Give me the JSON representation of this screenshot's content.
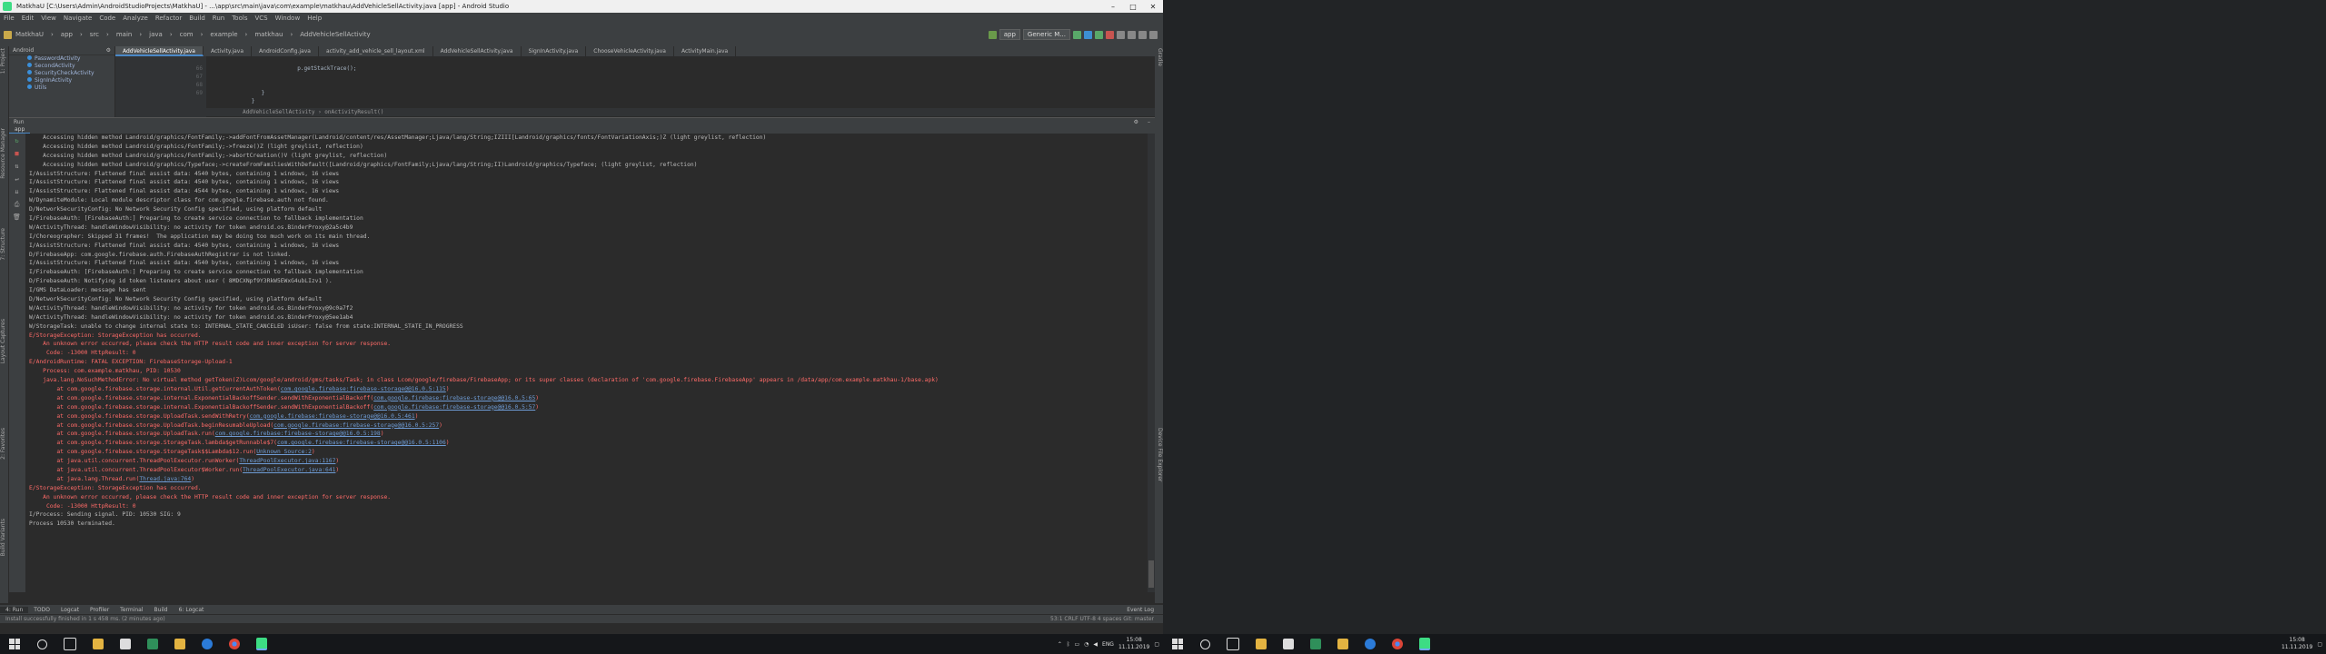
{
  "window": {
    "title": "MatkhaU [C:\\Users\\Admin\\AndroidStudioProjects\\MatkhaU] - ...\\app\\src\\main\\java\\com\\example\\matkhau\\AddVehicleSellActivity.java [app] - Android Studio"
  },
  "menu": [
    "File",
    "Edit",
    "View",
    "Navigate",
    "Code",
    "Analyze",
    "Refactor",
    "Build",
    "Run",
    "Tools",
    "VCS",
    "Window",
    "Help"
  ],
  "nav": {
    "crumbs": [
      "MatkhaU",
      "app",
      "src",
      "main",
      "java",
      "com",
      "example",
      "matkhau",
      "AddVehicleSellActivity"
    ],
    "run_config": "app",
    "device": "Generic M..."
  },
  "project": {
    "header": "Android",
    "items": [
      "PasswordActivity",
      "SecondActivity",
      "SecurityCheckActivity",
      "SignInActivity",
      "Utils"
    ]
  },
  "tabs": [
    "AddVehicleSellActivity.java",
    "Activity.java",
    "AndroidConfig.java",
    "activity_add_vehicle_sell_layout.xml",
    "AddVehicleSellActivity.java",
    "SignInActivity.java",
    "ChooseVehicleActivity.java",
    "ActivityMain.java"
  ],
  "editor": {
    "lines": [
      "",
      "                         p.getStackTrace();",
      "",
      "",
      "              }",
      "           }"
    ],
    "line_numbers": [
      "",
      "66",
      "67",
      "68",
      "69",
      ""
    ],
    "breadcrumb": "AddVehicleSellActivity  ›  onActivityResult()"
  },
  "run": {
    "panel_label": "Run",
    "tab": "app",
    "lines": [
      {
        "t": "    Accessing hidden method Landroid/graphics/FontFamily;->addFontFromAssetManager(Landroid/content/res/AssetManager;Ljava/lang/String;IZIII[Landroid/graphics/fonts/FontVariationAxis;)Z (light greylist, reflection)",
        "c": ""
      },
      {
        "t": "    Accessing hidden method Landroid/graphics/FontFamily;->freeze()Z (light greylist, reflection)",
        "c": ""
      },
      {
        "t": "    Accessing hidden method Landroid/graphics/FontFamily;->abortCreation()V (light greylist, reflection)",
        "c": ""
      },
      {
        "t": "    Accessing hidden method Landroid/graphics/Typeface;->createFromFamiliesWithDefault([Landroid/graphics/FontFamily;Ljava/lang/String;II)Landroid/graphics/Typeface; (light greylist, reflection)",
        "c": ""
      },
      {
        "t": "I/AssistStructure: Flattened final assist data: 4540 bytes, containing 1 windows, 16 views",
        "c": ""
      },
      {
        "t": "I/AssistStructure: Flattened final assist data: 4540 bytes, containing 1 windows, 16 views",
        "c": ""
      },
      {
        "t": "I/AssistStructure: Flattened final assist data: 4544 bytes, containing 1 windows, 16 views",
        "c": ""
      },
      {
        "t": "W/DynamiteModule: Local module descriptor class for com.google.firebase.auth not found.",
        "c": ""
      },
      {
        "t": "D/NetworkSecurityConfig: No Network Security Config specified, using platform default",
        "c": ""
      },
      {
        "t": "I/FirebaseAuth: [FirebaseAuth:] Preparing to create service connection to fallback implementation",
        "c": ""
      },
      {
        "t": "W/ActivityThread: handleWindowVisibility: no activity for token android.os.BinderProxy@2a5c4b9",
        "c": ""
      },
      {
        "t": "I/Choreographer: Skipped 31 frames!  The application may be doing too much work on its main thread.",
        "c": ""
      },
      {
        "t": "I/AssistStructure: Flattened final assist data: 4540 bytes, containing 1 windows, 16 views",
        "c": ""
      },
      {
        "t": "D/FirebaseApp: com.google.firebase.auth.FirebaseAuthRegistrar is not linked.",
        "c": ""
      },
      {
        "t": "I/AssistStructure: Flattened final assist data: 4540 bytes, containing 1 windows, 16 views",
        "c": ""
      },
      {
        "t": "I/FirebaseAuth: [FirebaseAuth:] Preparing to create service connection to fallback implementation",
        "c": ""
      },
      {
        "t": "D/FirebaseAuth: Notifying id token listeners about user ( 8MDCXNpf9Y3RkW5EWxG4ubLIzv1 ).",
        "c": ""
      },
      {
        "t": "I/GMS DataLoader: message has sent",
        "c": ""
      },
      {
        "t": "D/NetworkSecurityConfig: No Network Security Config specified, using platform default",
        "c": ""
      },
      {
        "t": "W/ActivityThread: handleWindowVisibility: no activity for token android.os.BinderProxy@9c0a7f2",
        "c": ""
      },
      {
        "t": "W/ActivityThread: handleWindowVisibility: no activity for token android.os.BinderProxy@5ee1ab4",
        "c": ""
      },
      {
        "t": "W/StorageTask: unable to change internal state to: INTERNAL_STATE_CANCELED isUser: false from state:INTERNAL_STATE_IN_PROGRESS",
        "c": ""
      },
      {
        "t": "E/StorageException: StorageException has occurred.",
        "c": "err"
      },
      {
        "t": "    An unknown error occurred, please check the HTTP result code and inner exception for server response.",
        "c": "err"
      },
      {
        "t": "     Code: -13000 HttpResult: 0",
        "c": "err"
      },
      {
        "t": "E/AndroidRuntime: FATAL EXCEPTION: FirebaseStorage-Upload-1",
        "c": "err"
      },
      {
        "t": "    Process: com.example.matkhau, PID: 10530",
        "c": "err"
      },
      {
        "t": "    java.lang.NoSuchMethodError: No virtual method getToken(Z)Lcom/google/android/gms/tasks/Task; in class Lcom/google/firebase/FirebaseApp; or its super classes (declaration of 'com.google.firebase.FirebaseApp' appears in /data/app/com.example.matkhau-1/base.apk)",
        "c": "err"
      },
      {
        "t": "        at com.google.firebase.storage.internal.Util.getCurrentAuthToken(",
        "c": "err",
        "u": "com.google.firebase:firebase-storage@@16.0.5:115",
        "tail": ")"
      },
      {
        "t": "        at com.google.firebase.storage.internal.ExponentialBackoffSender.sendWithExponentialBackoff(",
        "c": "err",
        "u": "com.google.firebase:firebase-storage@@16.0.5:65",
        "tail": ")"
      },
      {
        "t": "        at com.google.firebase.storage.internal.ExponentialBackoffSender.sendWithExponentialBackoff(",
        "c": "err",
        "u": "com.google.firebase:firebase-storage@@16.0.5:57",
        "tail": ")"
      },
      {
        "t": "        at com.google.firebase.storage.UploadTask.sendWithRetry(",
        "c": "err",
        "u": "com.google.firebase:firebase-storage@@16.0.5:461",
        "tail": ")"
      },
      {
        "t": "        at com.google.firebase.storage.UploadTask.beginResumableUpload(",
        "c": "err",
        "u": "com.google.firebase:firebase-storage@@16.0.5:257",
        "tail": ")"
      },
      {
        "t": "        at com.google.firebase.storage.UploadTask.run(",
        "c": "err",
        "u": "com.google.firebase:firebase-storage@@16.0.5:198",
        "tail": ")"
      },
      {
        "t": "        at com.google.firebase.storage.StorageTask.lambda$getRunnable$7(",
        "c": "err",
        "u": "com.google.firebase:firebase-storage@@16.0.5:1106",
        "tail": ")"
      },
      {
        "t": "        at com.google.firebase.storage.StorageTask$$Lambda$12.run(",
        "c": "err",
        "u": "Unknown Source:2",
        "tail": ")"
      },
      {
        "t": "        at java.util.concurrent.ThreadPoolExecutor.runWorker(",
        "c": "err",
        "u": "ThreadPoolExecutor.java:1167",
        "tail": ")"
      },
      {
        "t": "        at java.util.concurrent.ThreadPoolExecutor$Worker.run(",
        "c": "err",
        "u": "ThreadPoolExecutor.java:641",
        "tail": ")"
      },
      {
        "t": "        at java.lang.Thread.run(",
        "c": "err",
        "u": "Thread.java:764",
        "tail": ")"
      },
      {
        "t": "E/StorageException: StorageException has occurred.",
        "c": "err"
      },
      {
        "t": "    An unknown error occurred, please check the HTTP result code and inner exception for server response.",
        "c": "err"
      },
      {
        "t": "     Code: -13000 HttpResult: 0",
        "c": "err"
      },
      {
        "t": "I/Process: Sending signal. PID: 10530 SIG: 9",
        "c": ""
      },
      {
        "t": "Process 10530 terminated.",
        "c": ""
      },
      {
        "t": "",
        "c": ""
      }
    ]
  },
  "bottom_tabs": [
    "4: Run",
    "TODO",
    "Logcat",
    "Profiler",
    "Terminal",
    "Build",
    "6: Logcat"
  ],
  "bottom_right": "Event Log",
  "status": {
    "left": "Install successfully finished in 1 s 458 ms. (2 minutes ago)",
    "right": "53:1  CRLF  UTF-8  4 spaces  Git: master"
  },
  "left_tools": [
    "1: Project",
    "Resource Manager",
    "7: Structure",
    "Layout Captures",
    "2: Favorites",
    "Build Variants"
  ],
  "right_tools": [
    "Gradle",
    "Device File Explorer"
  ],
  "taskbar": {
    "lang": "ENG",
    "time": "15:08",
    "date": "11.11.2019"
  },
  "taskbar2": {
    "time": "15:08",
    "date": "11.11.2019"
  }
}
